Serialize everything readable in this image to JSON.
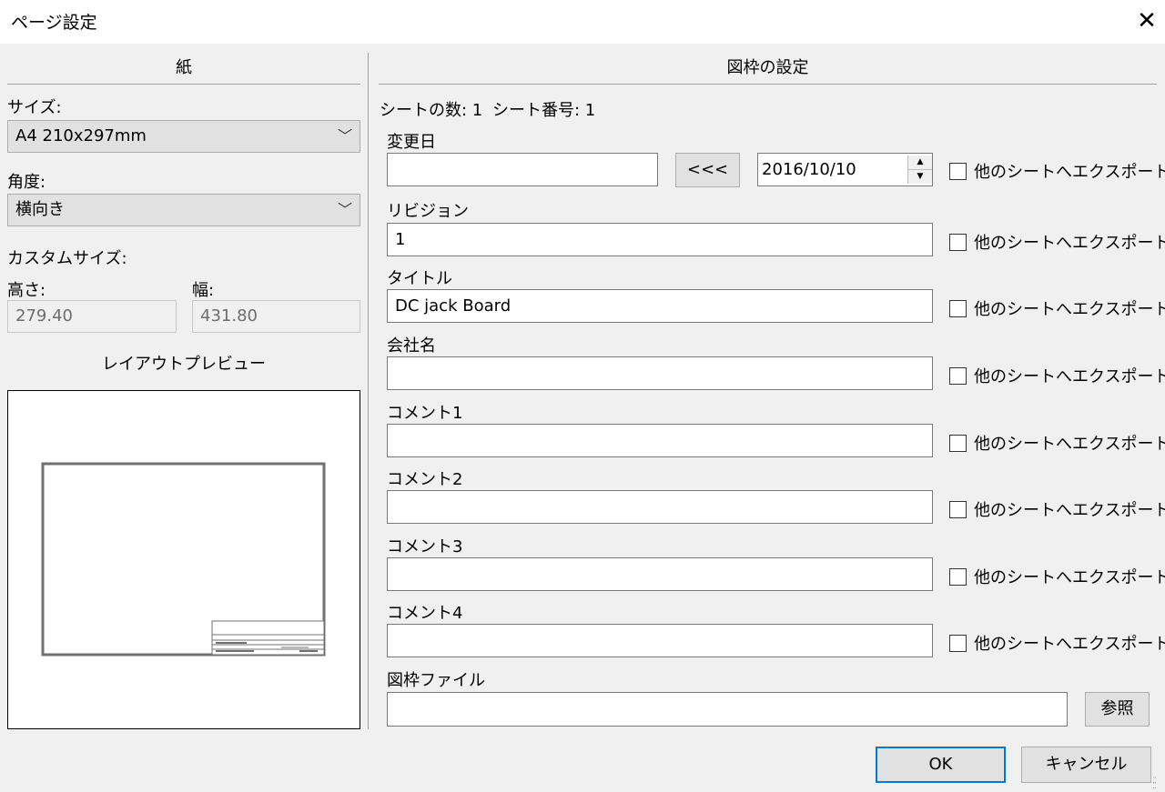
{
  "window": {
    "title": "ページ設定",
    "close_icon": "close-icon"
  },
  "paper": {
    "heading": "紙",
    "size_label": "サイズ:",
    "size_value": "A4 210x297mm",
    "orientation_label": "角度:",
    "orientation_value": "横向き",
    "custom_label": "カスタムサイズ:",
    "height_label": "高さ:",
    "height_value": "279.40",
    "width_label": "幅:",
    "width_value": "431.80",
    "preview_label": "レイアウトプレビュー"
  },
  "frame": {
    "heading": "図枠の設定",
    "sheet_count": "シートの数: 1",
    "sheet_number": "シート番号: 1",
    "export_label": "他のシートへエクスポート",
    "date": {
      "label": "変更日",
      "value": "",
      "copy_button": "<<<",
      "picker_value": "2016/10/10"
    },
    "revision": {
      "label": "リビジョン",
      "value": "1"
    },
    "title": {
      "label": "タイトル",
      "value": "DC jack Board"
    },
    "company": {
      "label": "会社名",
      "value": ""
    },
    "comment1": {
      "label": "コメント1",
      "value": ""
    },
    "comment2": {
      "label": "コメント2",
      "value": ""
    },
    "comment3": {
      "label": "コメント3",
      "value": ""
    },
    "comment4": {
      "label": "コメント4",
      "value": ""
    },
    "file": {
      "label": "図枠ファイル",
      "value": "",
      "browse_button": "参照"
    }
  },
  "buttons": {
    "ok": "OK",
    "cancel": "キャンセル"
  },
  "colors": {
    "accent": "#0078d7",
    "background": "#f0f0f0"
  }
}
